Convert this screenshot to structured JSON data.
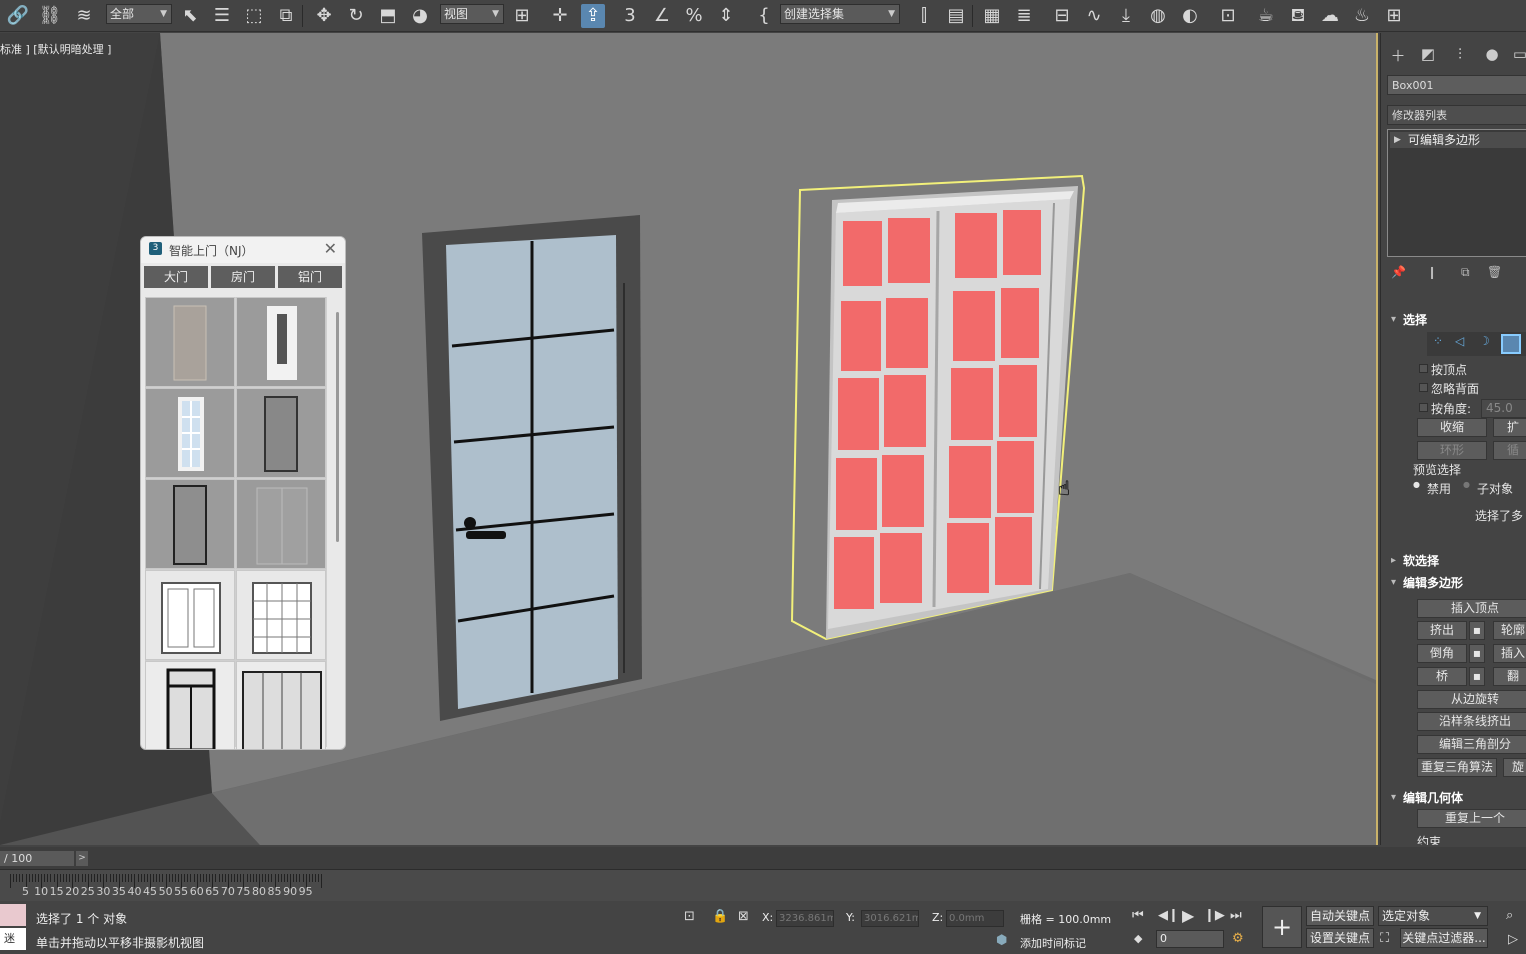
{
  "toolbar": {
    "filter_value": "全部",
    "ref_coord_value": "视图",
    "selection_set_placeholder": "创建选择集"
  },
  "viewport": {
    "label": "标准 ] [默认明暗处理 ]",
    "selection_color": "#f2f07a",
    "glass_color": "#f26a6a"
  },
  "plugin": {
    "title": "智能上门（NJ）",
    "tabs": [
      "大门",
      "房门",
      "铝门"
    ]
  },
  "command_panel": {
    "object_name": "Box001",
    "modifier_list": "修改器列表",
    "stack_item": "可编辑多边形",
    "rollouts": {
      "selection": "选择",
      "soft_selection": "软选择",
      "edit_poly": "编辑多边形",
      "edit_geometry": "编辑几何体"
    },
    "selection": {
      "by_vertex": "按顶点",
      "ignore_backfacing": "忽略背面",
      "by_angle": "按角度:",
      "angle_value": "45.0",
      "shrink": "收缩",
      "grow": "扩",
      "ring": "环形",
      "loop": "循",
      "preview_label": "预览选择",
      "preview_off": "禁用",
      "preview_sub": "子对象",
      "selected_info": "选择了多"
    },
    "edit_poly": {
      "insert_vertex": "插入顶点",
      "extrude": "挤出",
      "outline": "轮廓",
      "bevel": "倒角",
      "inset": "插入",
      "bridge": "桥",
      "flip": "翻",
      "hinge": "从边旋转",
      "extrude_spline": "沿样条线挤出",
      "edit_tri": "编辑三角剖分",
      "retriangulate": "重复三角算法",
      "turn": "旋"
    },
    "edit_geometry": {
      "repeat_last": "重复上一个",
      "constraints": "约束"
    }
  },
  "timeline": {
    "frame_display": "/ 100",
    "ticks": [
      "5",
      "10",
      "15",
      "20",
      "25",
      "30",
      "35",
      "40",
      "45",
      "50",
      "55",
      "60",
      "65",
      "70",
      "75",
      "80",
      "85",
      "90",
      "95"
    ]
  },
  "status": {
    "listener_label": "迷",
    "selection_info": "选择了 1 个 对象",
    "prompt": "单击并拖动以平移非摄影机视图",
    "x_label": "X:",
    "x_value": "3236.861m",
    "y_label": "Y:",
    "y_value": "3016.621m",
    "z_label": "Z:",
    "z_value": "0.0mm",
    "grid": "栅格 = 100.0mm",
    "add_time_tag": "添加时间标记",
    "auto_key": "自动关键点",
    "set_key": "设置关键点",
    "selected_dropdown": "选定对象",
    "key_filters": "关键点过滤器...",
    "frame_value": "0"
  }
}
